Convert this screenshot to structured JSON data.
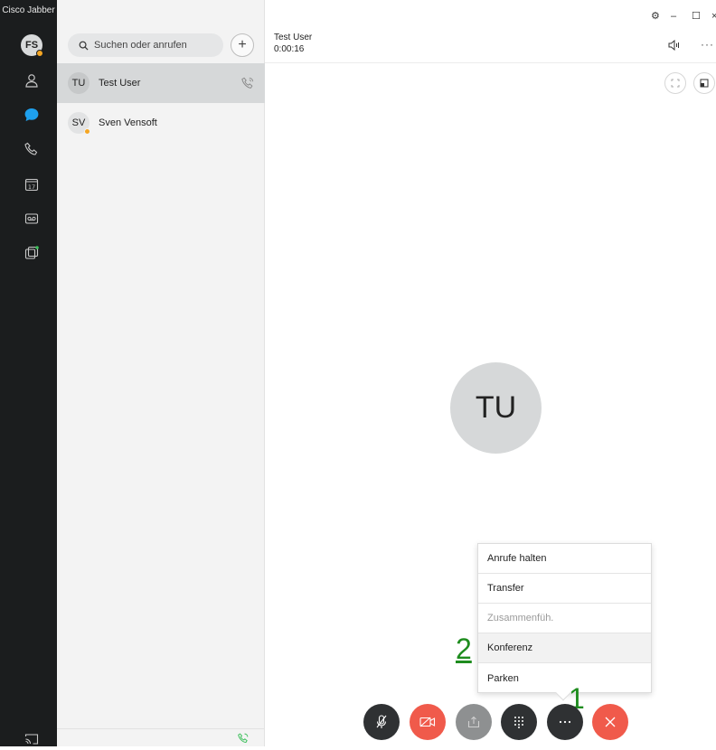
{
  "app": {
    "title": "Cisco Jabber"
  },
  "user": {
    "initials": "FS",
    "status_color": "#f5a623"
  },
  "nav": {
    "items": [
      {
        "id": "contacts",
        "icon": "person-icon"
      },
      {
        "id": "chats",
        "icon": "chat-bubble-icon",
        "active": true,
        "color": "#1ea0ee"
      },
      {
        "id": "calls",
        "icon": "phone-icon"
      },
      {
        "id": "meetings",
        "icon": "calendar-icon",
        "label": "17"
      },
      {
        "id": "voicemail",
        "icon": "voicemail-icon"
      },
      {
        "id": "custom",
        "icon": "custom-tab-icon"
      }
    ],
    "bottom_icon": "cast-screen-icon"
  },
  "search": {
    "placeholder": "Suchen oder anrufen"
  },
  "contacts": [
    {
      "initials": "TU",
      "name": "Test User",
      "selected": true,
      "in_call": true
    },
    {
      "initials": "SV",
      "name": "Sven Vensoft",
      "status_color": "#f5a623"
    }
  ],
  "call": {
    "name": "Test User",
    "duration": "0:00:16",
    "avatar_initials": "TU"
  },
  "window_controls": {
    "settings": "⚙",
    "minimize": "–",
    "maximize": "☐",
    "close": "×"
  },
  "menu": {
    "items": [
      {
        "label": "Anrufe halten",
        "enabled": true
      },
      {
        "label": "Transfer",
        "enabled": true
      },
      {
        "label": "Zusammenfüh.",
        "enabled": false
      },
      {
        "label": "Konferenz",
        "enabled": true,
        "hovered": true
      },
      {
        "label": "Parken",
        "enabled": true
      }
    ]
  },
  "annotations": {
    "marker1": "1",
    "marker2": "2",
    "color": "#1e8c1e"
  },
  "controls": {
    "mute": {
      "icon": "mic-off-icon",
      "color": "#2f3133"
    },
    "video": {
      "icon": "video-off-icon",
      "color": "#f05a4b"
    },
    "share": {
      "icon": "share-icon",
      "color": "#8e9091"
    },
    "keypad": {
      "icon": "keypad-icon",
      "color": "#2f3133"
    },
    "more": {
      "icon": "more-icon",
      "color": "#2f3133"
    },
    "end": {
      "icon": "end-call-icon",
      "color": "#f05a4b"
    }
  }
}
